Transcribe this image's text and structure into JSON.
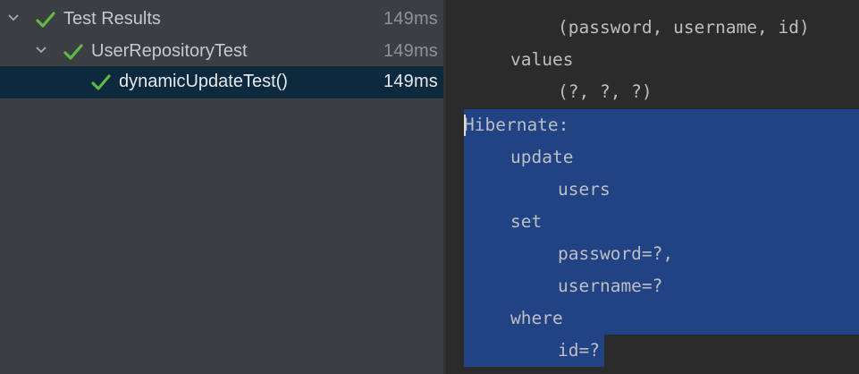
{
  "tree": [
    {
      "label": "Test Results",
      "time": "149ms",
      "expanded": true,
      "status": "passed"
    },
    {
      "label": "UserRepositoryTest",
      "time": "149ms",
      "expanded": true,
      "status": "passed"
    },
    {
      "label": "dynamicUpdateTest()",
      "time": "149ms",
      "selected": true,
      "status": "passed"
    }
  ],
  "console": {
    "lines": [
      "(password, username, id)",
      "values",
      "(?, ?, ?)",
      "Hibernate:",
      "update",
      "users",
      "set",
      "password=?,",
      "username=?",
      "where",
      "id=?"
    ]
  },
  "colors": {
    "pass_check": "#5fb946",
    "selection": "#214283",
    "tree_selection": "#0d293e"
  }
}
